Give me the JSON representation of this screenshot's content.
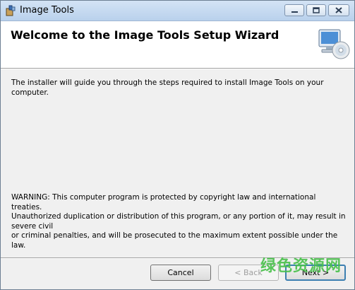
{
  "window": {
    "title": "Image Tools",
    "controls": {
      "minimize": "minimize-icon",
      "maximize": "maximize-icon",
      "close": "close-icon"
    }
  },
  "header": {
    "title": "Welcome to the Image Tools Setup Wizard",
    "image_icon": "computer-disc-icon"
  },
  "body": {
    "description": "The installer will guide you through the steps required to install Image Tools on your computer.",
    "warning_lines": [
      "WARNING: This computer program is protected by copyright law and international treaties.",
      "Unauthorized duplication or distribution of this program, or any portion of it, may result in severe civil",
      "or criminal penalties, and will be prosecuted to the maximum extent possible under the law."
    ]
  },
  "buttons": {
    "cancel": "Cancel",
    "back": "< Back",
    "next": "Next >"
  },
  "watermark": "绿色资源网",
  "colors": {
    "watermark": "#48c04a",
    "default_button_border": "#3c7fb1"
  }
}
